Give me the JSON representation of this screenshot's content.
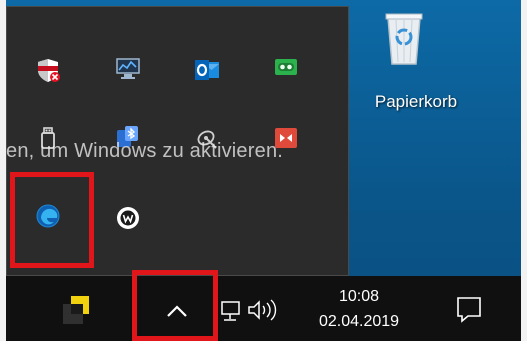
{
  "desktop": {
    "recycle_bin": {
      "label": "Papierkorb",
      "icon": "recycle-bin-icon"
    },
    "activation_watermark": "en, um Windows zu aktivieren."
  },
  "tray_flyout": {
    "icons": [
      {
        "name": "security-shield-icon",
        "color": "#e81123"
      },
      {
        "name": "network-monitor-icon",
        "color": "#3a7bd5"
      },
      {
        "name": "outlook-icon",
        "color": "#0072c6"
      },
      {
        "name": "chat-bubble-icon",
        "color": "#2bb24c"
      },
      {
        "name": "usb-drive-icon",
        "color": "#d9d9d9"
      },
      {
        "name": "bluetooth-device-icon",
        "color": "#2a6fd1"
      },
      {
        "name": "satellite-icon",
        "color": "#cfcfcf"
      },
      {
        "name": "remote-sync-icon",
        "color": "#e04a3a"
      },
      {
        "name": "edge-browser-icon",
        "color": "#1c8ad6"
      },
      {
        "name": "w-app-icon",
        "color": "#ffffff"
      }
    ]
  },
  "taskbar": {
    "sticky-notes-icon": "sticky-notes-icon",
    "show_hidden_icon": "chevron-up-icon",
    "network_icon": "network-icon",
    "volume_icon": "volume-icon",
    "clock": {
      "time": "10:08",
      "date": "02.04.2019"
    },
    "notifications_icon": "action-center-icon"
  },
  "highlight_color": "#e0161b"
}
